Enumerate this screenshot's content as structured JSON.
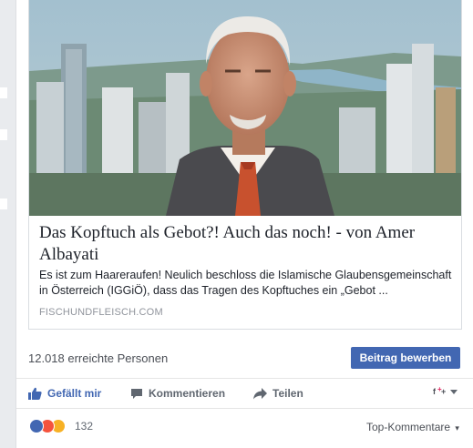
{
  "link_preview": {
    "headline": "Das Kopftuch als Gebot?! Auch das noch! - von Amer Albayati",
    "description": "Es ist zum Haareraufen! Neulich beschloss die Islamische Glaubensgemeinschaft in Österreich (IGGiÖ), dass das Tragen des Kopftuches ein „Gebot ...",
    "domain": "FISCHUNDFLEISCH.COM"
  },
  "reach": {
    "text": "12.018 erreichte Personen",
    "boost_label": "Beitrag bewerben"
  },
  "actions": {
    "like": "Gefällt mir",
    "comment": "Kommentieren",
    "share": "Teilen"
  },
  "reactions": {
    "count": "132",
    "icons": [
      "like-icon",
      "angry-icon",
      "haha-icon"
    ]
  },
  "comments_sort": {
    "label": "Top-Kommentare"
  },
  "colors": {
    "brand": "#4267b2",
    "link": "#365899"
  }
}
